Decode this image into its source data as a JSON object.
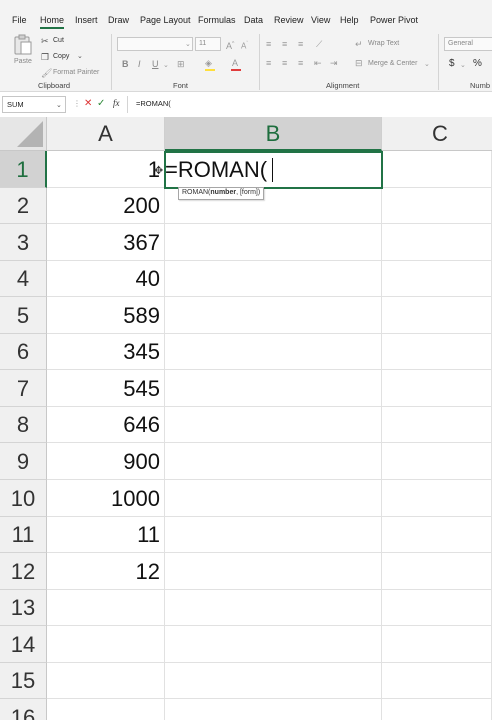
{
  "menu": {
    "tabs": [
      "File",
      "Home",
      "Insert",
      "Draw",
      "Page Layout",
      "Formulas",
      "Data",
      "Review",
      "View",
      "Help",
      "Power Pivot"
    ],
    "active": "Home"
  },
  "ribbon": {
    "clipboard": {
      "paste": "Paste",
      "cut": "Cut",
      "copy": "Copy",
      "format_painter": "Format Painter",
      "label": "Clipboard"
    },
    "font": {
      "size": "11",
      "bold": "B",
      "italic": "I",
      "underline": "U",
      "label": "Font"
    },
    "alignment": {
      "wrap_text": "Wrap Text",
      "merge_center": "Merge & Center",
      "label": "Alignment"
    },
    "number": {
      "format": "General",
      "currency": "$",
      "percent": "%",
      "label": "Numb"
    }
  },
  "formula_bar": {
    "name_box": "SUM",
    "fx": "fx",
    "content": "=ROMAN("
  },
  "grid": {
    "columns": [
      "A",
      "B",
      "C"
    ],
    "rows": [
      "1",
      "2",
      "3",
      "4",
      "5",
      "6",
      "7",
      "8",
      "9",
      "10",
      "11",
      "12",
      "13",
      "14",
      "15",
      "16"
    ],
    "column_a_values": [
      "1",
      "200",
      "367",
      "40",
      "589",
      "345",
      "545",
      "646",
      "900",
      "1000",
      "11",
      "12",
      "",
      "",
      "",
      ""
    ],
    "active_cell_text": "=ROMAN(",
    "tooltip": {
      "func": "ROMAN(",
      "arg1": "number",
      "rest": ", [form])"
    }
  }
}
